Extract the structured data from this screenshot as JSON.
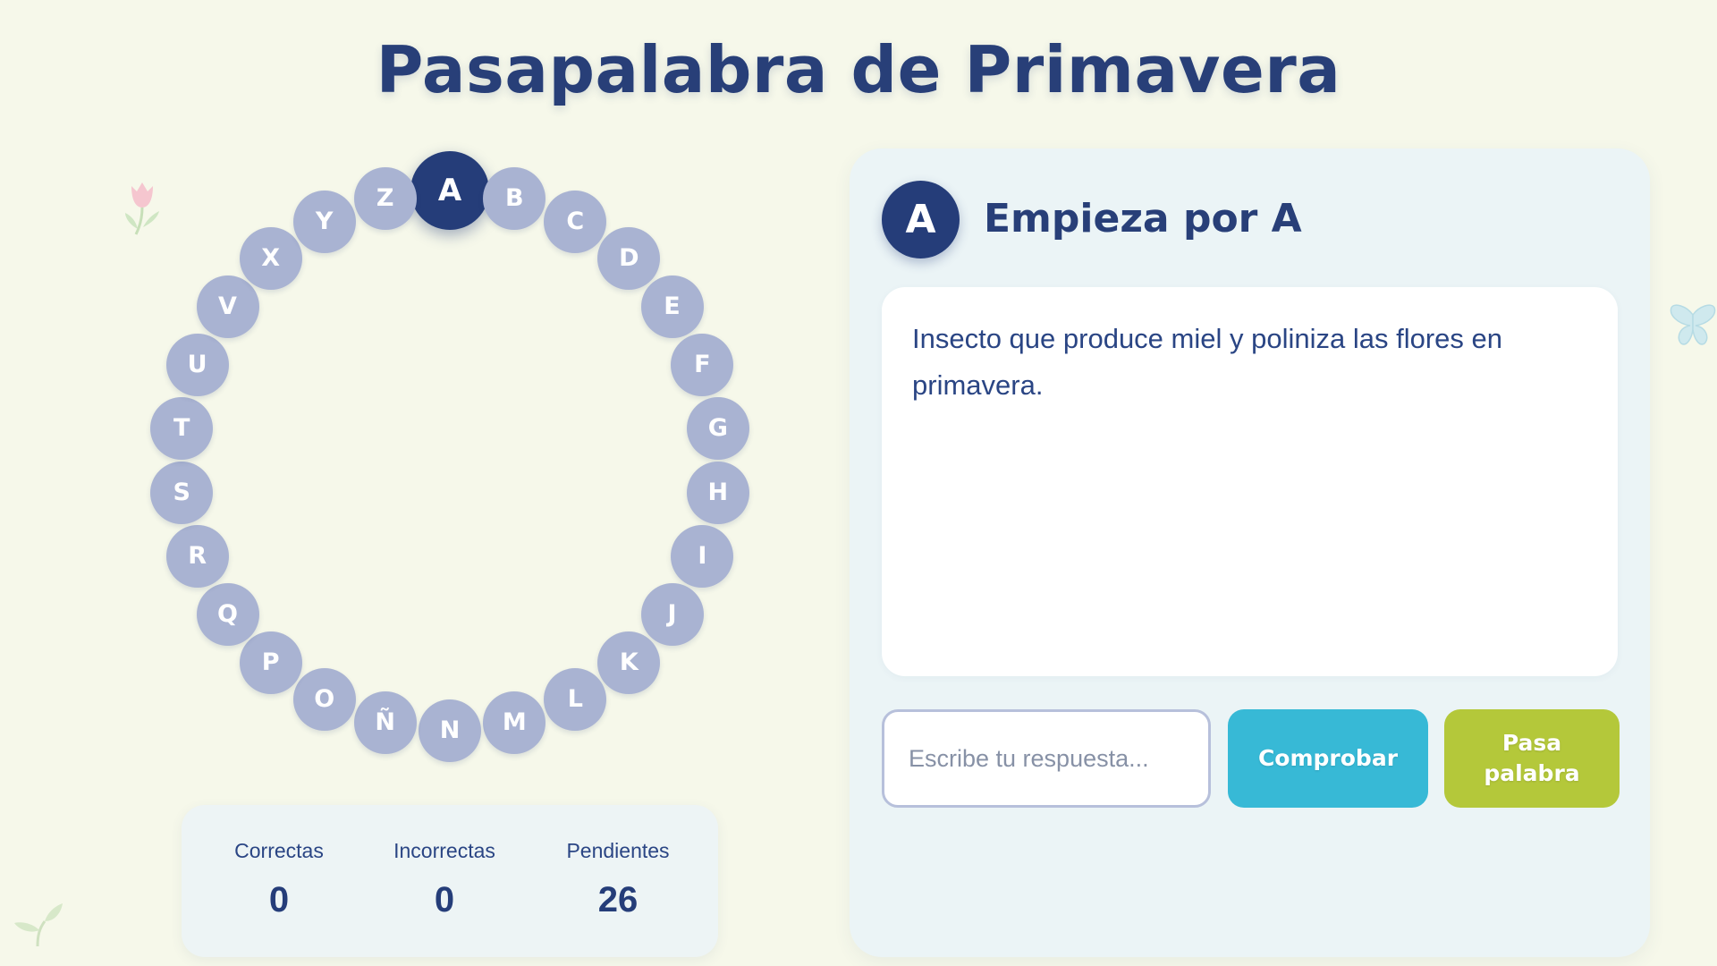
{
  "title": "Pasapalabra de Primavera",
  "rosco": {
    "active_letter": "A",
    "letters": [
      "A",
      "B",
      "C",
      "D",
      "E",
      "F",
      "G",
      "H",
      "I",
      "J",
      "K",
      "L",
      "M",
      "N",
      "Ñ",
      "O",
      "P",
      "Q",
      "R",
      "S",
      "T",
      "U",
      "V",
      "X",
      "Y",
      "Z"
    ]
  },
  "stats": {
    "correct_label": "Correctas",
    "correct_value": "0",
    "incorrect_label": "Incorrectas",
    "incorrect_value": "0",
    "pending_label": "Pendientes",
    "pending_value": "26"
  },
  "question": {
    "badge": "A",
    "heading": "Empieza por A",
    "clue": "Insecto que produce miel y poliniza las flores en primavera."
  },
  "answer": {
    "placeholder": "Escribe tu respuesta...",
    "value": ""
  },
  "buttons": {
    "check_label": "Comprobar",
    "pass_label": "Pasa\npalabra"
  },
  "colors": {
    "background": "#f6f8ea",
    "primary": "#253d79",
    "letter_pending": "#a9b3d2",
    "check_button": "#37b9d6",
    "pass_button": "#b4c83a"
  },
  "decorations": [
    "tulip-icon",
    "butterfly-icon",
    "sprout-icon"
  ]
}
